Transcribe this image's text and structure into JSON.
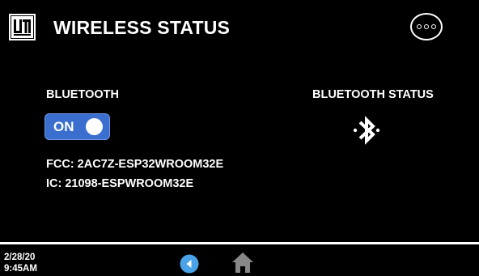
{
  "header": {
    "title": "WIRELESS STATUS",
    "logo_icon": "brand-logo-icon",
    "menu_icon": "more-options-icon"
  },
  "bluetooth": {
    "label": "BLUETOOTH",
    "toggle_state": "ON",
    "status_label": "BLUETOOTH STATUS",
    "status_icon": "bluetooth-icon"
  },
  "ids": {
    "fcc": "FCC: 2AC7Z-ESP32WROOM32E",
    "ic": "IC: 21098-ESPWROOM32E"
  },
  "footer": {
    "date": "2/28/20",
    "time": "9:45AM",
    "back_icon": "back-arrow-icon",
    "home_icon": "home-icon"
  },
  "colors": {
    "background": "#000000",
    "text": "#ffffff",
    "toggle_on": "#3a6fd0",
    "back_button": "#4aa3e8",
    "home_icon": "#888888"
  }
}
